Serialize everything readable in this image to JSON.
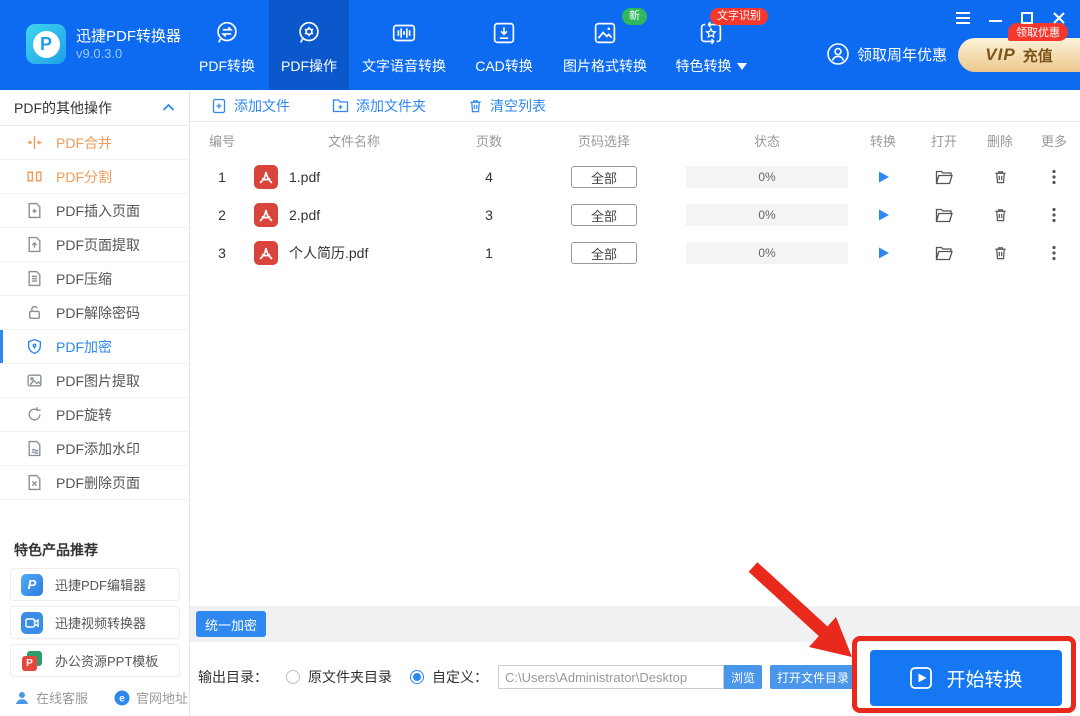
{
  "app": {
    "title": "迅捷PDF转换器",
    "version": "v9.0.3.0"
  },
  "nav": {
    "tabs": [
      {
        "label": "PDF转换"
      },
      {
        "label": "PDF操作",
        "active": true
      },
      {
        "label": "文字语音转换"
      },
      {
        "label": "CAD转换"
      },
      {
        "label": "图片格式转换",
        "badge": "新"
      },
      {
        "label": "特色转换",
        "badge": "文字识别"
      }
    ]
  },
  "promo": {
    "anniversary": "领取周年优惠",
    "vip": "VIP",
    "recharge": "充值",
    "vip_badge": "领取优惠"
  },
  "sidebar": {
    "section_title": "PDF的其他操作",
    "items": [
      {
        "label": "PDF合并"
      },
      {
        "label": "PDF分割"
      },
      {
        "label": "PDF插入页面"
      },
      {
        "label": "PDF页面提取"
      },
      {
        "label": "PDF压缩"
      },
      {
        "label": "PDF解除密码"
      },
      {
        "label": "PDF加密"
      },
      {
        "label": "PDF图片提取"
      },
      {
        "label": "PDF旋转"
      },
      {
        "label": "PDF添加水印"
      },
      {
        "label": "PDF删除页面"
      }
    ],
    "products_title": "特色产品推荐",
    "products": [
      {
        "label": "迅捷PDF编辑器"
      },
      {
        "label": "迅捷视频转换器"
      },
      {
        "label": "办公资源PPT模板"
      }
    ],
    "footer_links": [
      {
        "label": "在线客服"
      },
      {
        "label": "官网地址"
      }
    ]
  },
  "toolbar": {
    "add_file": "添加文件",
    "add_folder": "添加文件夹",
    "clear_list": "清空列表"
  },
  "table": {
    "headers": [
      "编号",
      "文件名称",
      "页数",
      "页码选择",
      "状态",
      "转换",
      "打开",
      "删除",
      "更多"
    ],
    "rows": [
      {
        "no": "1",
        "name": "1.pdf",
        "pages": "4",
        "page_select": "全部",
        "status": "0%"
      },
      {
        "no": "2",
        "name": "2.pdf",
        "pages": "3",
        "page_select": "全部",
        "status": "0%"
      },
      {
        "no": "3",
        "name": "个人简历.pdf",
        "pages": "1",
        "page_select": "全部",
        "status": "0%"
      }
    ]
  },
  "footer": {
    "unify_button": "统一加密",
    "output_label": "输出目录：",
    "radio_original": "原文件夹目录",
    "radio_custom": "自定义：",
    "path_value": "C:\\Users\\Administrator\\Desktop",
    "browse_button": "浏览",
    "open_dir_button": "打开文件目录",
    "start_button": "开始转换"
  },
  "colors": {
    "header_blue": "#0d6bf2",
    "active_tab_blue": "#0b58cd",
    "accent_blue": "#2e88f0",
    "sidebar_orange": "#f09b57",
    "annotation_red": "#e8291c",
    "badge_green": "#2fb95d",
    "badge_red": "#f5382e",
    "vip_gold_text": "#7d531a",
    "pdf_icon_red": "#d9453d"
  }
}
